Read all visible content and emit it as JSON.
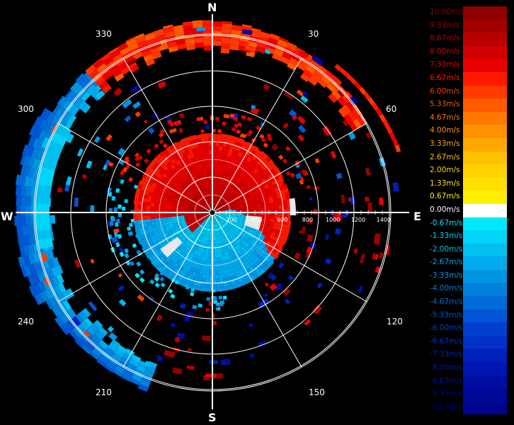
{
  "compass": {
    "north": "N",
    "south": "S",
    "east": "E",
    "west": "W",
    "bearings": [
      "30",
      "60",
      "120",
      "150",
      "210",
      "240",
      "300",
      "330"
    ]
  },
  "range_rings": [
    "200",
    "400",
    "600",
    "800",
    "1000",
    "1200",
    "1400"
  ],
  "legend": [
    {
      "label": "10.00m/s",
      "color": "#8e0000"
    },
    {
      "label": "9.33m/s",
      "color": "#a00000"
    },
    {
      "label": "8.67m/s",
      "color": "#b80000"
    },
    {
      "label": "8.00m/s",
      "color": "#d20000"
    },
    {
      "label": "7.33m/s",
      "color": "#e80000"
    },
    {
      "label": "6.67m/s",
      "color": "#ff1800"
    },
    {
      "label": "6.00m/s",
      "color": "#ff3a00"
    },
    {
      "label": "5.33m/s",
      "color": "#ff5a00"
    },
    {
      "label": "4.67m/s",
      "color": "#ff7800"
    },
    {
      "label": "4.00m/s",
      "color": "#ff9000"
    },
    {
      "label": "3.33m/s",
      "color": "#ffa800"
    },
    {
      "label": "2.67m/s",
      "color": "#ffc000"
    },
    {
      "label": "2.00m/s",
      "color": "#ffd200"
    },
    {
      "label": "1.33m/s",
      "color": "#ffe000"
    },
    {
      "label": "0.67m/s",
      "color": "#fff000"
    },
    {
      "label": "0.00m/s",
      "color": "#ffffff"
    },
    {
      "label": "-0.67m/s",
      "color": "#00e8ff"
    },
    {
      "label": "-1.33m/s",
      "color": "#00d4f8"
    },
    {
      "label": "-2.00m/s",
      "color": "#00c0f0"
    },
    {
      "label": "-2.67m/s",
      "color": "#00aaec"
    },
    {
      "label": "-3.33m/s",
      "color": "#0096e4"
    },
    {
      "label": "-4.00m/s",
      "color": "#0080dc"
    },
    {
      "label": "-4.67m/s",
      "color": "#006cd8"
    },
    {
      "label": "-5.33m/s",
      "color": "#0056d4"
    },
    {
      "label": "-6.00m/s",
      "color": "#0040d0"
    },
    {
      "label": "-6.67m/s",
      "color": "#0030c8"
    },
    {
      "label": "-7.33m/s",
      "color": "#0020bc"
    },
    {
      "label": "-8.00m/s",
      "color": "#0016b0"
    },
    {
      "label": "-8.67m/s",
      "color": "#000ea4"
    },
    {
      "label": "-9.33m/s",
      "color": "#000898"
    },
    {
      "label": "-10.00m/s",
      "color": "#00048c"
    }
  ]
}
